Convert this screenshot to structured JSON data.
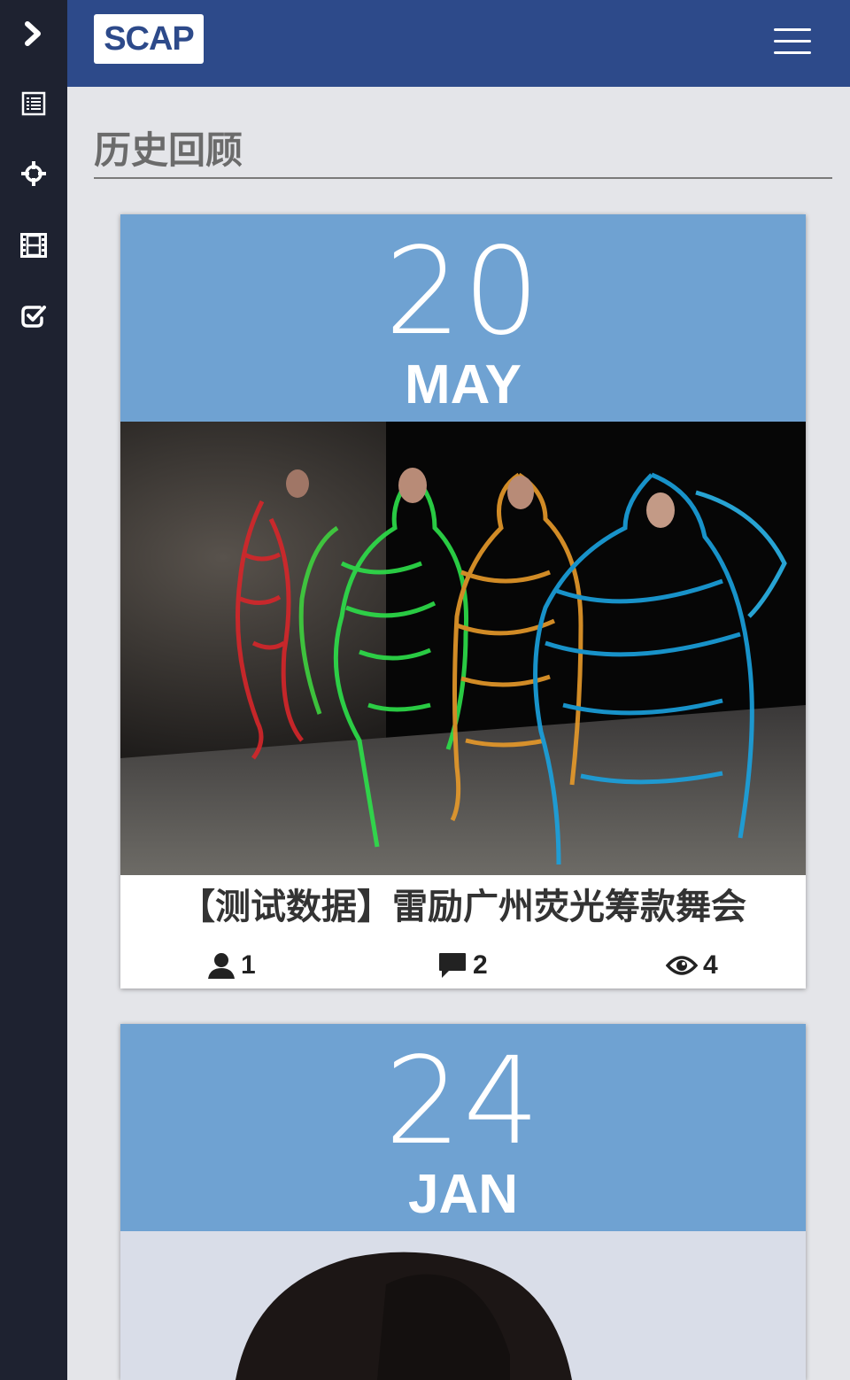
{
  "app": {
    "logo_text": "SCAP"
  },
  "sidebar": {
    "items": [
      {
        "icon": "chevron-right-icon"
      },
      {
        "icon": "list-icon"
      },
      {
        "icon": "crosshair-icon"
      },
      {
        "icon": "film-icon"
      },
      {
        "icon": "checkbox-icon"
      }
    ]
  },
  "page": {
    "section_title": "历史回顾"
  },
  "events": [
    {
      "day": "20",
      "month": "MAY",
      "title": "【测试数据】雷励广州荧光筹款舞会",
      "participants": "1",
      "comments": "2",
      "views": "4"
    },
    {
      "day": "24",
      "month": "JAN"
    }
  ],
  "colors": {
    "sidebar": "#1e2230",
    "topbar": "#2d4a8a",
    "date_block": "#6fa2d2",
    "background": "#e4e5e9"
  }
}
